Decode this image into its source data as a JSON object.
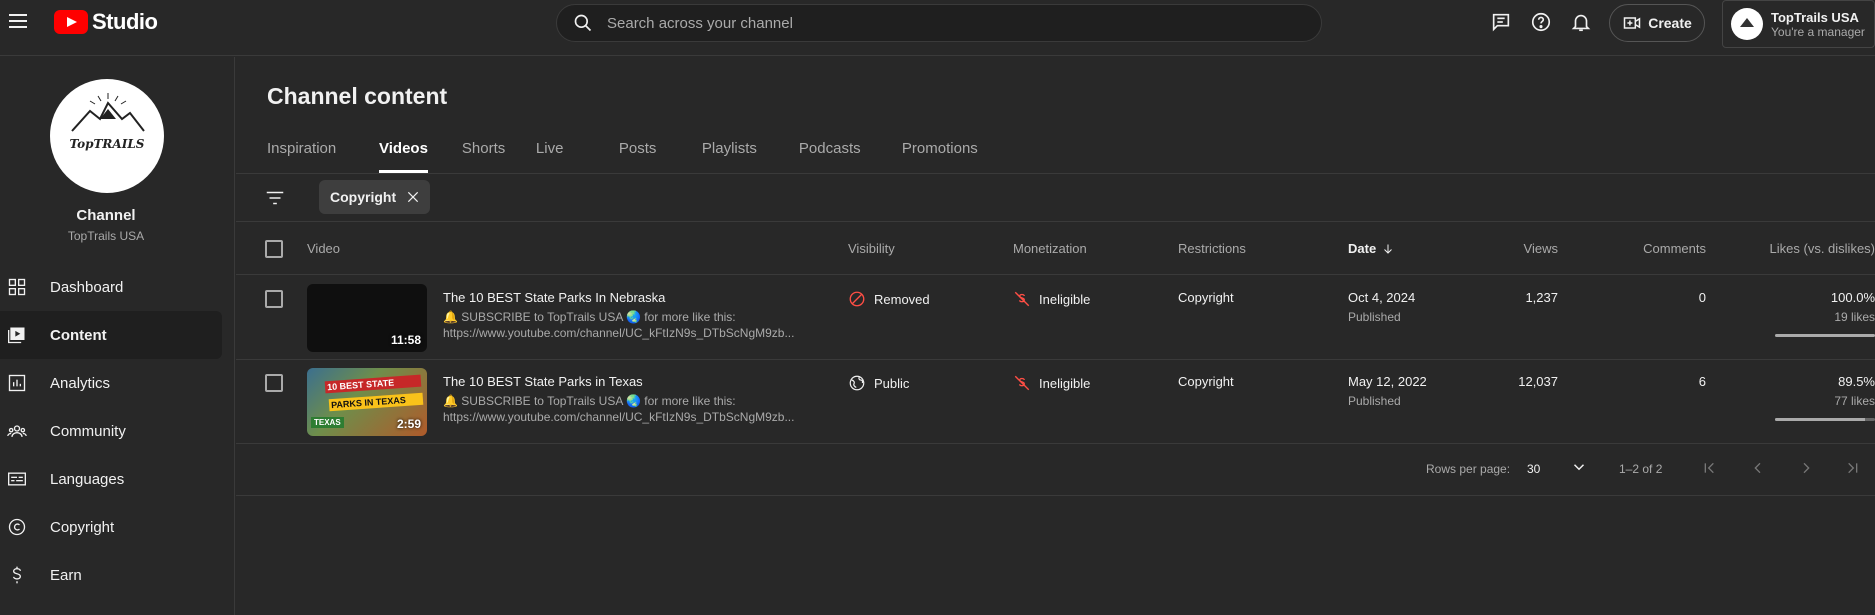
{
  "app": {
    "logo_text": "Studio",
    "search_placeholder": "Search across your channel",
    "create_label": "Create",
    "account_name": "TopTrails USA",
    "account_role": "You're a manager"
  },
  "sidebar": {
    "channel_label": "Channel",
    "channel_name": "TopTrails USA",
    "logo_text": "TopTRAILS",
    "items": [
      {
        "label": "Dashboard",
        "icon": "dashboard-icon"
      },
      {
        "label": "Content",
        "icon": "content-icon",
        "active": true
      },
      {
        "label": "Analytics",
        "icon": "analytics-icon"
      },
      {
        "label": "Community",
        "icon": "community-icon"
      },
      {
        "label": "Languages",
        "icon": "languages-icon"
      },
      {
        "label": "Copyright",
        "icon": "copyright-icon"
      },
      {
        "label": "Earn",
        "icon": "earn-icon"
      }
    ]
  },
  "main": {
    "title": "Channel content",
    "tabs": [
      {
        "label": "Inspiration"
      },
      {
        "label": "Videos",
        "active": true
      },
      {
        "label": "Shorts"
      },
      {
        "label": "Live"
      },
      {
        "label": "Posts"
      },
      {
        "label": "Playlists"
      },
      {
        "label": "Podcasts"
      },
      {
        "label": "Promotions"
      }
    ],
    "filter_chip": "Copyright",
    "columns": {
      "video": "Video",
      "visibility": "Visibility",
      "monetization": "Monetization",
      "restrictions": "Restrictions",
      "date": "Date",
      "views": "Views",
      "comments": "Comments",
      "likes": "Likes (vs. dislikes)"
    },
    "rows": [
      {
        "title": "The 10 BEST State Parks In Nebraska",
        "desc_line1": "🔔 SUBSCRIBE to TopTrails USA 🌏 for more like this:",
        "desc_line2": "https://www.youtube.com/channel/UC_kFtIzN9s_DTbScNgM9zb...",
        "duration": "11:58",
        "visibility": "Removed",
        "monetization": "Ineligible",
        "restrictions": "Copyright",
        "date": "Oct 4, 2024",
        "date_status": "Published",
        "views": "1,237",
        "comments": "0",
        "likes_pct": "100.0%",
        "likes_count": "19 likes",
        "likes_fraction": 1.0
      },
      {
        "title": "The 10 BEST State Parks in Texas",
        "desc_line1": "🔔 SUBSCRIBE to TopTrails USA 🌏 for more like this:",
        "desc_line2": "https://www.youtube.com/channel/UC_kFtIzN9s_DTbScNgM9zb...",
        "duration": "2:59",
        "thumb_text_1": "10 BEST STATE",
        "thumb_text_2": "PARKS IN TEXAS",
        "thumb_text_3": "TEXAS",
        "visibility": "Public",
        "monetization": "Ineligible",
        "restrictions": "Copyright",
        "date": "May 12, 2022",
        "date_status": "Published",
        "views": "12,037",
        "comments": "6",
        "likes_pct": "89.5%",
        "likes_count": "77 likes",
        "likes_fraction": 0.895
      }
    ],
    "pagination": {
      "rows_per_page_label": "Rows per page:",
      "rows_per_page": "30",
      "range": "1–2 of 2"
    }
  },
  "colors": {
    "background": "#282828",
    "youtube_red": "#ff0000",
    "text_primary": "#f1f1f1",
    "text_secondary": "#aaaaaa"
  }
}
